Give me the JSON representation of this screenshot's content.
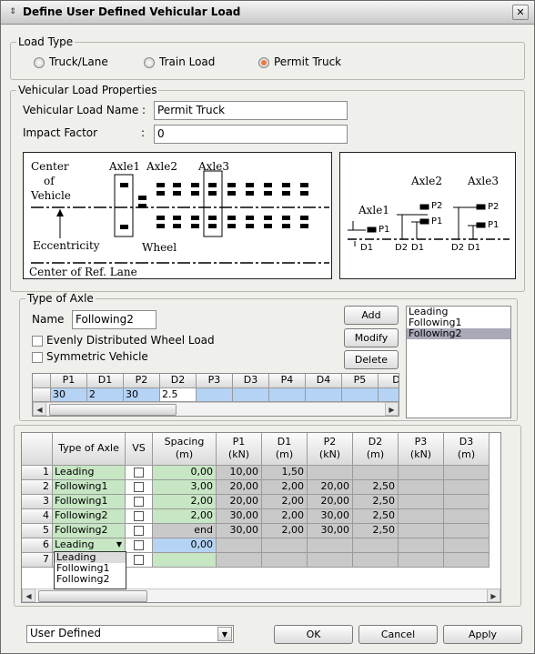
{
  "window": {
    "title": "Define User Defined Vehicular Load",
    "close_glyph": "✕",
    "title_icon": "chevron-updown-icon"
  },
  "load_type": {
    "label": "Load Type",
    "options": [
      "Truck/Lane",
      "Train Load",
      "Permit Truck"
    ],
    "selected": "Permit Truck"
  },
  "properties": {
    "label": "Vehicular Load Properties",
    "name_label": "Vehicular Load Name :",
    "name_value": "Permit Truck",
    "impact_label": "Impact Factor",
    "impact_colon": ":",
    "impact_value": "0"
  },
  "diagram_left": {
    "center": "Center",
    "of": "of",
    "vehicle": "Vehicle",
    "axle1": "Axle1",
    "axle2": "Axle2",
    "axle3": "Axle3",
    "wheel": "Wheel",
    "eccentricity": "Eccentricity",
    "ref_lane": "Center of Ref. Lane"
  },
  "diagram_right": {
    "axle1": "Axle1",
    "axle2": "Axle2",
    "axle3": "Axle3",
    "p1": "P1",
    "p2": "P2",
    "d1": "D1",
    "d2": "D2"
  },
  "axle_type": {
    "label": "Type of Axle",
    "name_label": "Name",
    "name_value": "Following2",
    "evenly_label": "Evenly Distributed Wheel Load",
    "symmetric_label": "Symmetric Vehicle",
    "add": "Add",
    "modify": "Modify",
    "delete": "Delete",
    "list": [
      "Leading",
      "Following1",
      "Following2"
    ],
    "list_selected": "Following2",
    "small_headers": [
      "P1",
      "D1",
      "P2",
      "D2",
      "P3",
      "D3",
      "P4",
      "D4",
      "P5",
      "D"
    ],
    "small_values": [
      "30",
      "2",
      "30",
      "2.5",
      "",
      "",
      "",
      "",
      "",
      ""
    ]
  },
  "table": {
    "headers": [
      {
        "l1": "Type of Axle",
        "l2": ""
      },
      {
        "l1": "VS",
        "l2": ""
      },
      {
        "l1": "Spacing",
        "l2": "(m)"
      },
      {
        "l1": "P1",
        "l2": "(kN)"
      },
      {
        "l1": "D1",
        "l2": "(m)"
      },
      {
        "l1": "P2",
        "l2": "(kN)"
      },
      {
        "l1": "D2",
        "l2": "(m)"
      },
      {
        "l1": "P3",
        "l2": "(kN)"
      },
      {
        "l1": "D3",
        "l2": "(m)"
      }
    ],
    "rows": [
      {
        "n": "1",
        "type": "Leading",
        "spacing": "0,00",
        "p1": "10,00",
        "d1": "1,50",
        "p2": "",
        "d2": ""
      },
      {
        "n": "2",
        "type": "Following1",
        "spacing": "3,00",
        "p1": "20,00",
        "d1": "2,00",
        "p2": "20,00",
        "d2": "2,50"
      },
      {
        "n": "3",
        "type": "Following1",
        "spacing": "2,00",
        "p1": "20,00",
        "d1": "2,00",
        "p2": "20,00",
        "d2": "2,50"
      },
      {
        "n": "4",
        "type": "Following2",
        "spacing": "2,00",
        "p1": "30,00",
        "d1": "2,00",
        "p2": "30,00",
        "d2": "2,50"
      },
      {
        "n": "5",
        "type": "Following2",
        "spacing": "end",
        "p1": "30,00",
        "d1": "2,00",
        "p2": "30,00",
        "d2": "2,50"
      },
      {
        "n": "6",
        "type": "Leading",
        "spacing": "0,00",
        "p1": "",
        "d1": "",
        "p2": "",
        "d2": ""
      },
      {
        "n": "7",
        "type": "",
        "spacing": "",
        "p1": "",
        "d1": "",
        "p2": "",
        "d2": ""
      }
    ],
    "dropdown_options": [
      "Leading",
      "Following1",
      "Following2"
    ]
  },
  "footer": {
    "select_value": "User Defined",
    "ok": "OK",
    "cancel": "Cancel",
    "apply": "Apply"
  }
}
